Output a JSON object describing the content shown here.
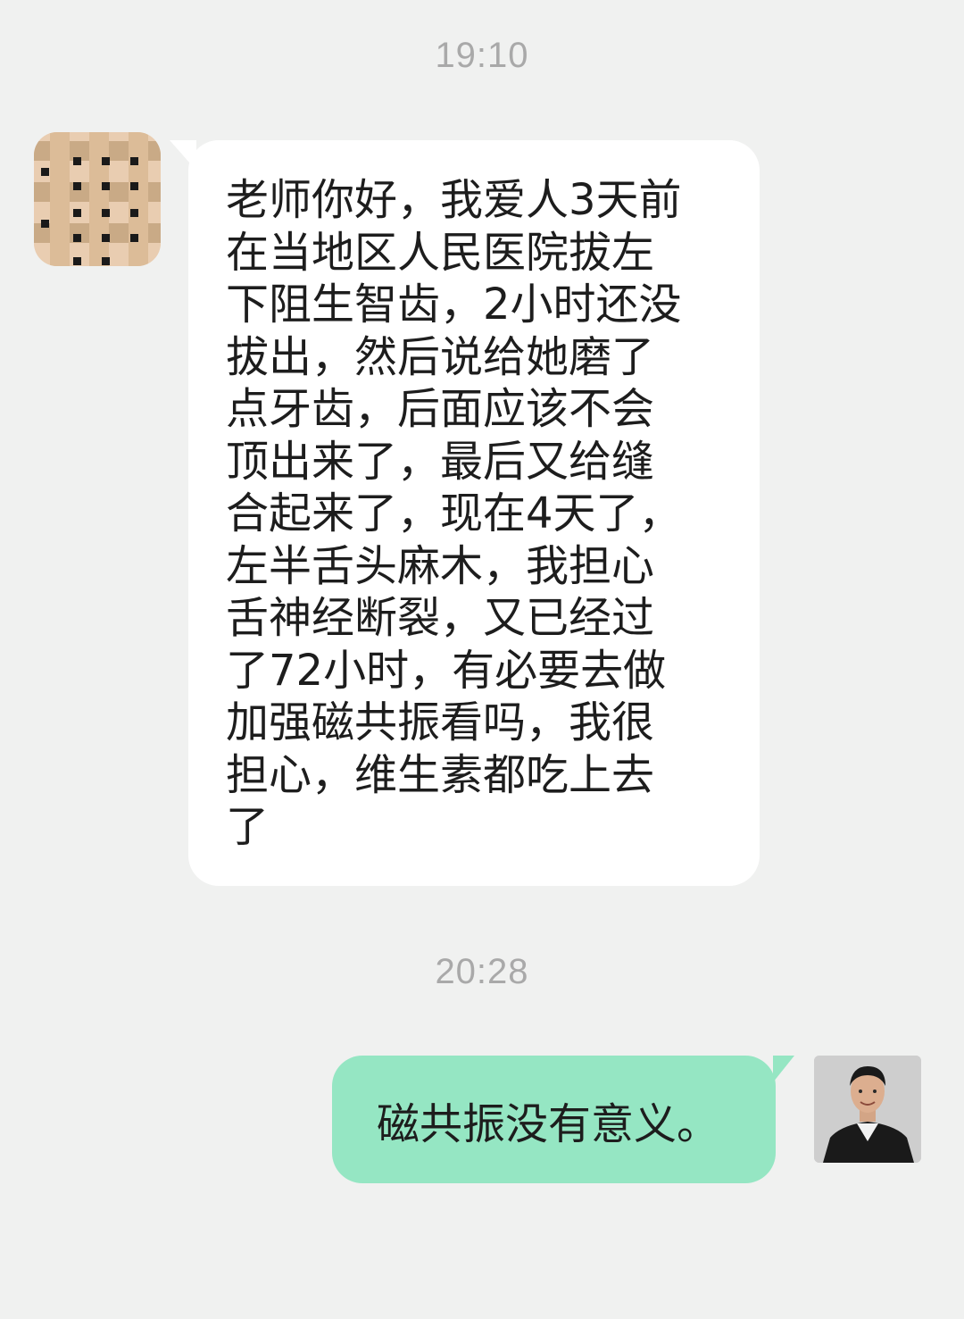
{
  "chat": {
    "messages": [
      {
        "time": "19:10",
        "sender": "other",
        "text": "老师你好，我爱人3天前\n在当地区人民医院拔左\n下阻生智齿，2小时还没\n拔出，然后说给她磨了\n点牙齿，后面应该不会\n顶出来了，最后又给缝\n合起来了，现在4天了，\n左半舌头麻木，我担心\n舌神经断裂，又已经过\n了72小时，有必要去做\n加强磁共振看吗，我很\n担心，维生素都吃上去\n了"
      },
      {
        "time": "20:28",
        "sender": "me",
        "text": "磁共振没有意义。"
      }
    ]
  },
  "colors": {
    "background": "#f0f1f0",
    "incoming_bubble": "#ffffff",
    "outgoing_bubble": "#95e6c3",
    "timestamp": "#a9a9a9",
    "text": "#1d1d1d"
  },
  "icons": {
    "left_avatar": "pixelated-avatar-icon",
    "right_avatar": "user-photo-avatar-icon"
  }
}
